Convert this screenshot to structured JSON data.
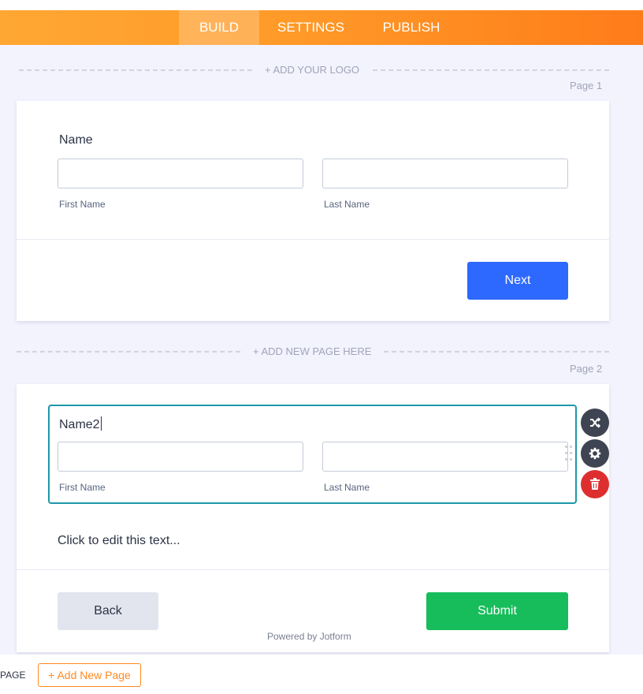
{
  "nav": {
    "tabs": [
      {
        "label": "BUILD",
        "active": true
      },
      {
        "label": "SETTINGS",
        "active": false
      },
      {
        "label": "PUBLISH",
        "active": false
      }
    ]
  },
  "form": {
    "add_logo": "+ ADD YOUR LOGO",
    "add_new_page_here": "+ ADD NEW PAGE HERE",
    "page1": {
      "label": "Page 1",
      "field": {
        "label": "Name",
        "first_sublabel": "First Name",
        "last_sublabel": "Last Name",
        "first_value": "",
        "last_value": ""
      },
      "next_button": "Next"
    },
    "page2": {
      "label": "Page 2",
      "field": {
        "label": "Name2",
        "first_sublabel": "First Name",
        "last_sublabel": "Last Name",
        "first_value": "",
        "last_value": ""
      },
      "text_element": "Click to edit this text...",
      "back_button": "Back",
      "submit_button": "Submit",
      "powered_by": "Powered by Jotform"
    },
    "field_tools": [
      "shuffle-icon",
      "gear-icon",
      "trash-icon"
    ]
  },
  "bottom_bar": {
    "page_text": "PAGE",
    "add_page_button": "+ Add New Page"
  },
  "colors": {
    "nav_orange": "#ff9a28",
    "next_blue": "#2e69ff",
    "submit_green": "#18bd5b",
    "selection_teal": "#1d98a9",
    "delete_red": "#dd2f2f"
  }
}
